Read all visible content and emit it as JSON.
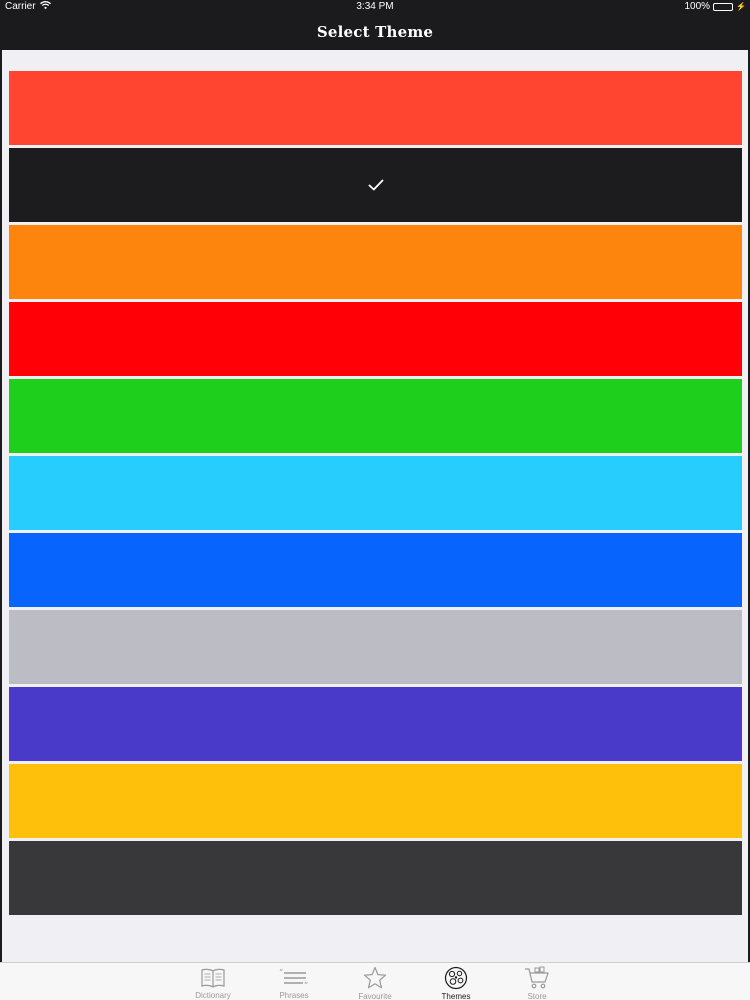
{
  "status": {
    "carrier": "Carrier",
    "time": "3:34 PM",
    "battery": "100%"
  },
  "nav": {
    "title": "Select Theme"
  },
  "themes": [
    {
      "color": "#ff4530",
      "selected": false
    },
    {
      "color": "#1c1c1e",
      "selected": true
    },
    {
      "color": "#fd850e",
      "selected": false
    },
    {
      "color": "#fe0006",
      "selected": false
    },
    {
      "color": "#1ecf1c",
      "selected": false
    },
    {
      "color": "#27cdfd",
      "selected": false
    },
    {
      "color": "#0764fc",
      "selected": false
    },
    {
      "color": "#bcbcc4",
      "selected": false
    },
    {
      "color": "#4a3ac9",
      "selected": false
    },
    {
      "color": "#fec00a",
      "selected": false
    },
    {
      "color": "#38383a",
      "selected": false
    }
  ],
  "tabs": [
    {
      "label": "Dictionary",
      "icon": "book-icon",
      "active": false
    },
    {
      "label": "Phrases",
      "icon": "phrases-icon",
      "active": false
    },
    {
      "label": "Favourite",
      "icon": "star-icon",
      "active": false
    },
    {
      "label": "Themes",
      "icon": "themes-icon",
      "active": true
    },
    {
      "label": "Store",
      "icon": "cart-icon",
      "active": false
    }
  ]
}
